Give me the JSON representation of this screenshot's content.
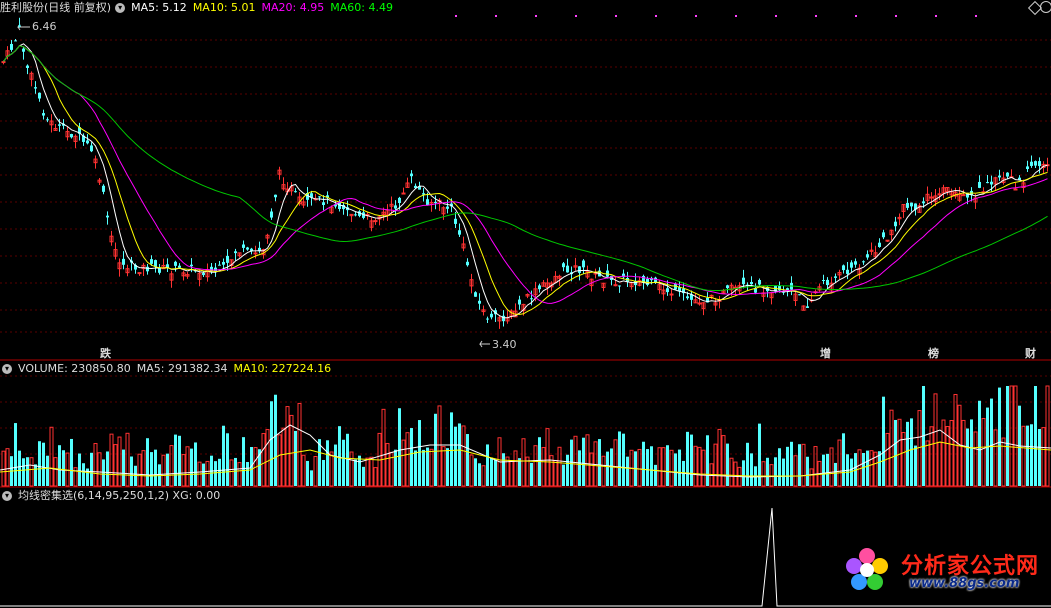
{
  "main_panel": {
    "title": "胜利股份(日线 前复权)",
    "indicators": [
      {
        "text": "MA5: 5.12",
        "color": "#ffffff"
      },
      {
        "text": "MA10: 5.01",
        "color": "#ffff00"
      },
      {
        "text": "MA20: 4.95",
        "color": "#ff00ff"
      },
      {
        "text": "MA60: 4.49",
        "color": "#00ff00"
      }
    ],
    "high_label": "6.46",
    "low_label": "3.40",
    "events": [
      {
        "text": "跌",
        "color": "#00ff00"
      },
      {
        "text": "增",
        "color": "#ff3333"
      },
      {
        "text": "榜",
        "color": "#ff3333"
      },
      {
        "text": "财",
        "color": "#00ffff"
      }
    ],
    "diamond_icon": "diamond-icon"
  },
  "volume_panel": {
    "indicators": [
      {
        "text": "VOLUME: 230850.80",
        "color": "#dddddd"
      },
      {
        "text": "MA5: 291382.34",
        "color": "#dddddd"
      },
      {
        "text": "MA10: 227224.16",
        "color": "#ffff00"
      }
    ]
  },
  "indicator_panel": {
    "title": "均线密集选(6,14,95,250,1,2) XG: 0.00"
  },
  "watermark": {
    "name": "分析家公式网",
    "url": "www.88gs.com"
  },
  "colors": {
    "up": "#ff3232",
    "down": "#54ffff",
    "ma5": "#ffffff",
    "ma10": "#ffff00",
    "ma20": "#ff00ff",
    "ma60": "#00c800",
    "separator": "#b00000"
  }
}
